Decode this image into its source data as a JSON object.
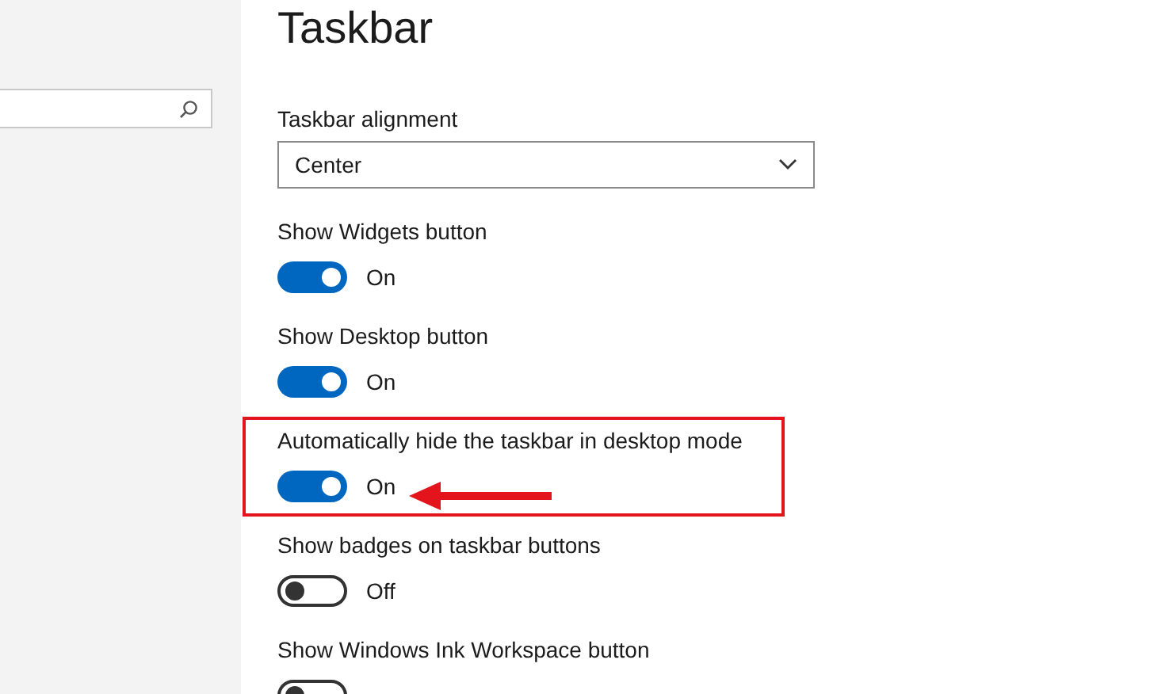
{
  "page": {
    "title": "Taskbar"
  },
  "settings": [
    {
      "kind": "dropdown",
      "label": "Taskbar alignment",
      "value": "Center",
      "highlighted": false
    },
    {
      "kind": "toggle",
      "label": "Show Widgets button",
      "on": true,
      "state_text": "On",
      "highlighted": false
    },
    {
      "kind": "toggle",
      "label": "Show Desktop button",
      "on": true,
      "state_text": "On",
      "highlighted": false
    },
    {
      "kind": "toggle",
      "label": "Automatically hide the taskbar in desktop mode",
      "on": true,
      "state_text": "On",
      "highlighted": true
    },
    {
      "kind": "toggle",
      "label": "Show badges on taskbar buttons",
      "on": false,
      "state_text": "Off",
      "highlighted": false
    },
    {
      "kind": "toggle",
      "label": "Show Windows Ink Workspace button",
      "on": false,
      "highlighted": false
    }
  ]
}
